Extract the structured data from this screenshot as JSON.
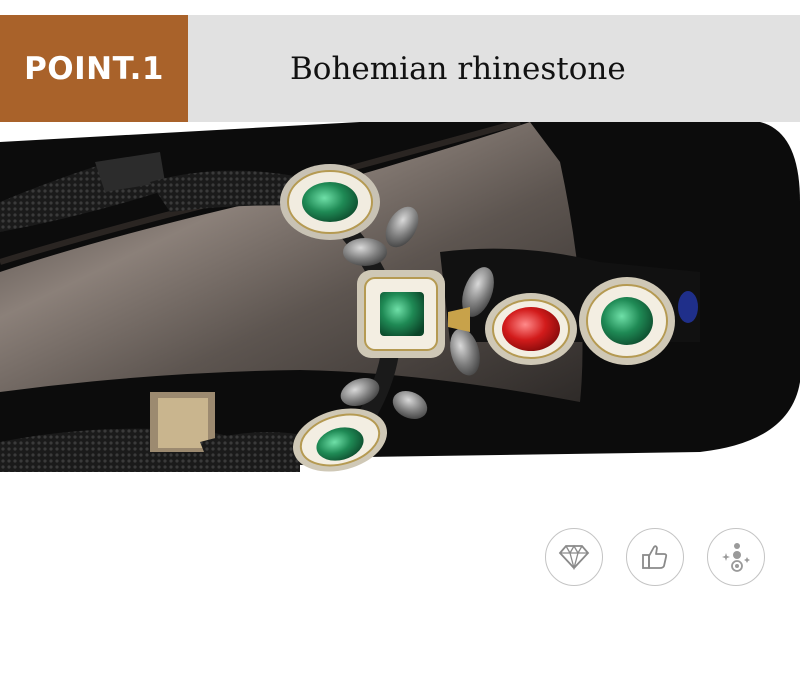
{
  "header": {
    "tag_label": "POINT.1",
    "title": "Bohemian rhinestone"
  },
  "colors": {
    "tag_background": "#a9622a",
    "banner_background": "#e1e1e1",
    "emerald": "#1f8a55",
    "ruby": "#d21b1b",
    "sole": "#0c0c0c",
    "insole": "#6a605a"
  },
  "feature_icons": [
    {
      "icon": "diamond-icon"
    },
    {
      "icon": "thumbs-up-icon"
    },
    {
      "icon": "sparkle-gems-icon"
    }
  ]
}
